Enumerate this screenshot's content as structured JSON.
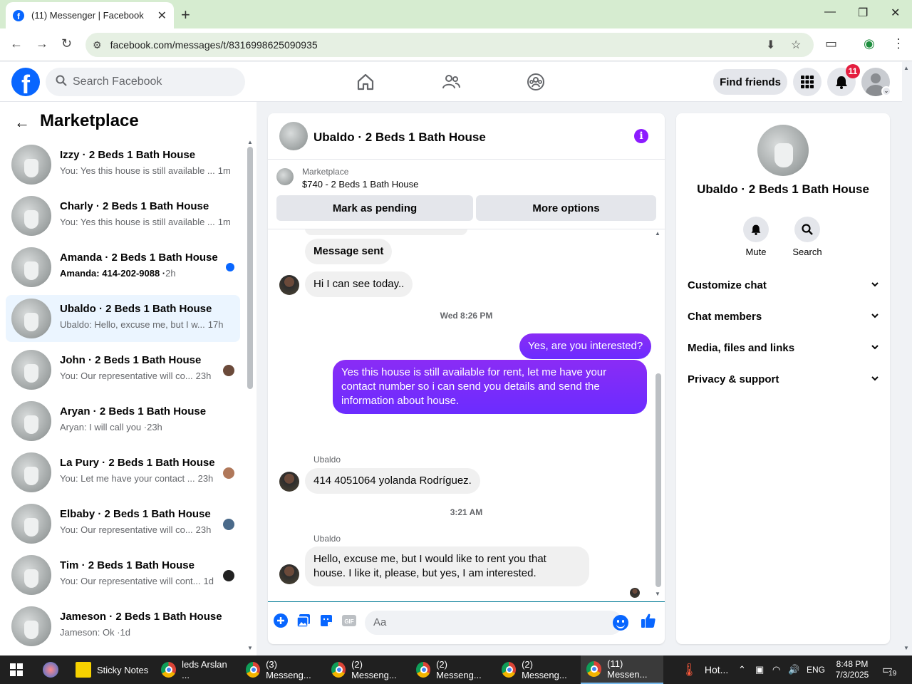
{
  "browser": {
    "tab_title": "(11) Messenger | Facebook",
    "url": "facebook.com/messages/t/8316998625090935"
  },
  "fb": {
    "search_placeholder": "Search Facebook",
    "find_friends": "Find friends",
    "notification_count": "11"
  },
  "sidebar": {
    "title": "Marketplace",
    "conversations": [
      {
        "name": "Izzy · 2 Beds 1 Bath House",
        "preview": "You: Yes this house is still available ...",
        "time": "1m",
        "bold": false,
        "indicator": "none"
      },
      {
        "name": "Charly · 2 Beds 1 Bath House",
        "preview": "You: Yes this house is still available ...",
        "time": "1m",
        "bold": false,
        "indicator": "none"
      },
      {
        "name": "Amanda · 2 Beds 1 Bath House",
        "preview": "Amanda: 414-202-9088 ·",
        "time": "2h",
        "bold": true,
        "indicator": "unread"
      },
      {
        "name": "Ubaldo · 2 Beds 1 Bath House",
        "preview": "Ubaldo: Hello, excuse me, but I w...",
        "time": "17h",
        "bold": false,
        "indicator": "none"
      },
      {
        "name": "John · 2 Beds 1 Bath House",
        "preview": "You: Our representative will co...",
        "time": "23h",
        "bold": false,
        "indicator": "seen"
      },
      {
        "name": "Aryan · 2 Beds 1 Bath House",
        "preview": "Aryan: I will call you ·",
        "time": "23h",
        "bold": false,
        "indicator": "none"
      },
      {
        "name": "La Pury · 2 Beds 1 Bath House",
        "preview": "You: Let me have your contact ...",
        "time": "23h",
        "bold": false,
        "indicator": "seen"
      },
      {
        "name": "Elbaby · 2 Beds 1 Bath House",
        "preview": "You: Our representative will co...",
        "time": "23h",
        "bold": false,
        "indicator": "seen"
      },
      {
        "name": "Tim · 2 Beds 1 Bath House",
        "preview": "You: Our representative will cont...",
        "time": "1d",
        "bold": false,
        "indicator": "seen"
      },
      {
        "name": "Jameson · 2 Beds 1 Bath House",
        "preview": "Jameson: Ok ·",
        "time": "1d",
        "bold": false,
        "indicator": "none"
      }
    ]
  },
  "chat": {
    "title": "Ubaldo · 2 Beds 1 Bath House",
    "marketplace_label": "Marketplace",
    "listing": "$740 - 2 Beds 1 Bath House",
    "mark_pending": "Mark as pending",
    "more_options": "More options",
    "messages": {
      "m1": "Message sent",
      "m2": "Hi I can see today..",
      "sep1": "Wed 8:26 PM",
      "m3": "Yes, are you interested?",
      "m4": "Yes this house is still available for rent, let me have your contact number so i can send you details and send the information about house.",
      "sender1": "Ubaldo",
      "m5": "414 4051064 yolanda Rodríguez.",
      "sep2": "3:21 AM",
      "sender2": "Ubaldo",
      "m6": "Hello, excuse me, but I would like to rent you that house. I like it, please, but yes, I am interested."
    },
    "composer_placeholder": "Aa",
    "accent_color": "#7a2cff"
  },
  "right_panel": {
    "name": "Ubaldo · 2 Beds 1 Bath House",
    "mute": "Mute",
    "search": "Search",
    "sections": [
      "Customize chat",
      "Chat members",
      "Media, files and links",
      "Privacy & support"
    ]
  },
  "taskbar": {
    "items": [
      "Sticky Notes",
      "leds Arslan ...",
      "(3) Messeng...",
      "(2) Messeng...",
      "(2) Messeng...",
      "(2) Messeng...",
      "(11) Messen..."
    ],
    "weather": "Hot...",
    "lang": "ENG",
    "time": "8:48 PM",
    "date": "7/3/2025",
    "notif": "19"
  }
}
